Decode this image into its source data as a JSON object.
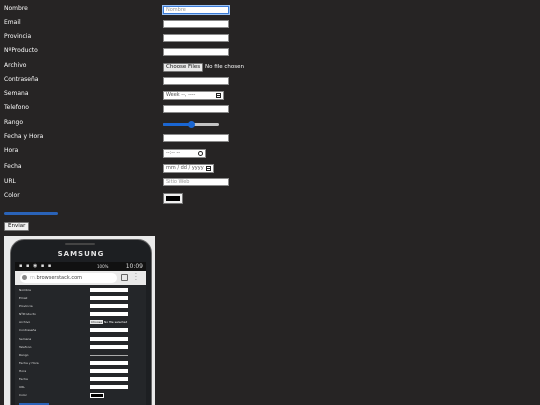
{
  "form": {
    "labels": {
      "nombre": "Nombre",
      "email": "Email",
      "provincia": "Provincia",
      "nproducto": "NºProducto",
      "archivo": "Archivo",
      "contrasena": "Contraseña",
      "semana": "Semana",
      "telefono": "Telefono",
      "rango": "Rango",
      "fecha_hora": "Fecha y Hora",
      "hora": "Hora",
      "fecha": "Fecha",
      "url": "URL",
      "color": "Color"
    },
    "placeholders": {
      "nombre": "Nombre",
      "url": "Sitio Web"
    },
    "file_button": "Choose Files",
    "file_status": "No file chosen",
    "week_value": "Week --, ----",
    "time_value": "--:-- --",
    "date_value": "mm / dd / yyyy",
    "range_value": 0.5,
    "color_value": "#000000",
    "progress_value": 1.0,
    "submit": "Enviar"
  },
  "phone": {
    "brand": "SAMSUNG",
    "clock": "10:09",
    "signal": "100%",
    "url_prefix": "m.",
    "url_domain": "browserstack.com",
    "labels": [
      "Nombre",
      "Email",
      "Provincia",
      "NºProducto",
      "Archivo",
      "Contraseña",
      "Semana",
      "Telefono",
      "Rango",
      "Fecha y Hora",
      "Hora",
      "Fecha",
      "URL",
      "Color"
    ],
    "file_button": "Choose",
    "file_status": "No file selected"
  },
  "colors": {
    "background": "#262424",
    "accent": "#1a66d2"
  }
}
